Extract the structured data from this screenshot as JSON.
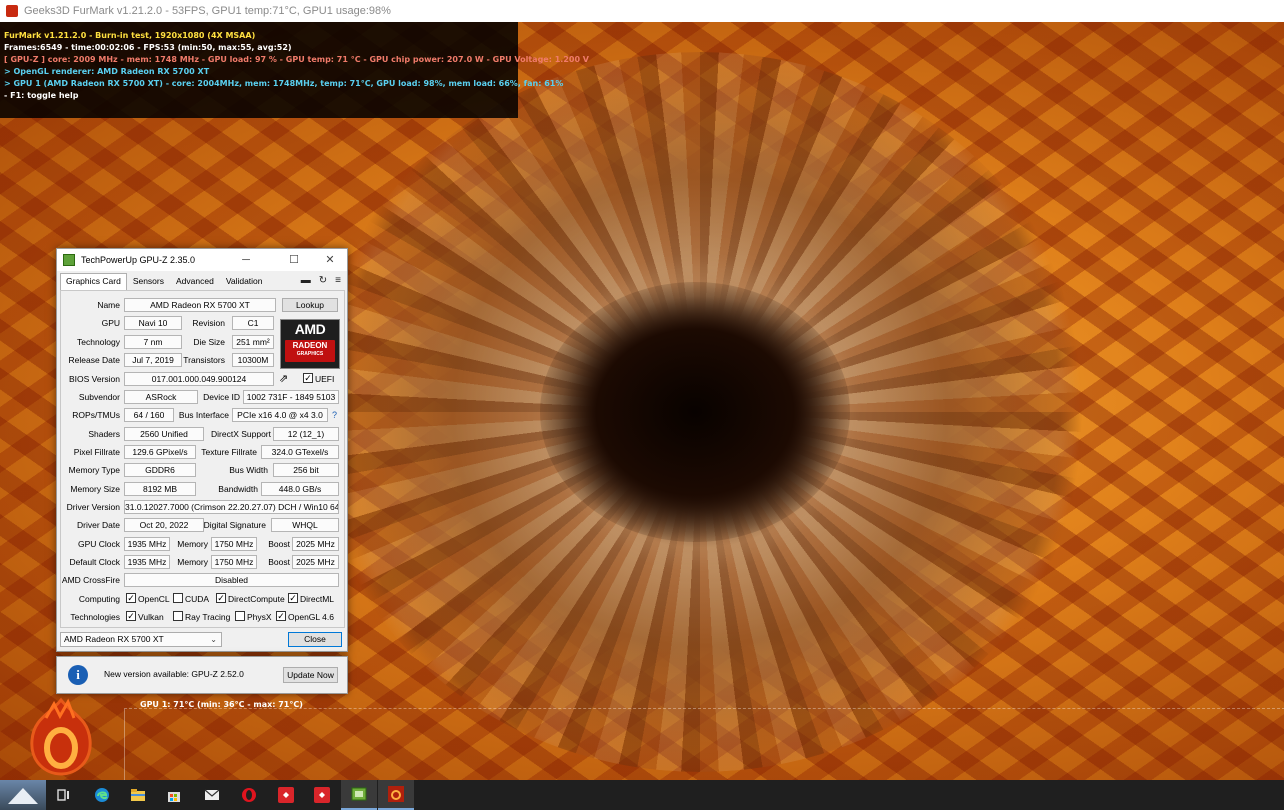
{
  "furmark": {
    "window_title": "Geeks3D FurMark v1.21.2.0 - 53FPS, GPU1 temp:71°C, GPU1 usage:98%",
    "overlay": {
      "line1": "FurMark v1.21.2.0 - Burn-in test, 1920x1080 (4X MSAA)",
      "line2": "Frames:6549 - time:00:02:06 - FPS:53 (min:50, max:55, avg:52)",
      "line3": "[ GPU-Z ] core: 2009 MHz - mem: 1748 MHz - GPU load: 97 % - GPU temp: 71 °C - GPU chip power: 207.0 W - GPU Voltage: 1.200 V",
      "line4": "> OpenGL renderer: AMD Radeon RX 5700 XT",
      "line5": "> GPU 1 (AMD Radeon RX 5700 XT) - core: 2004MHz, mem: 1748MHz, temp: 71°C, GPU load: 98%, mem load: 66%, fan: 61%",
      "line6": "- F1: toggle help"
    },
    "temp_graph_label": "GPU 1: 71°C (min: 36°C - max: 71°C)",
    "colors": {
      "yellow": "#ffe040",
      "pink": "#f07b6a",
      "cyan": "#5ad0f0"
    }
  },
  "gpuz": {
    "title": "TechPowerUp GPU-Z 2.35.0",
    "tabs": [
      "Graphics Card",
      "Sensors",
      "Advanced",
      "Validation"
    ],
    "lookup_label": "Lookup",
    "logo": {
      "brand": "AMD",
      "line1": "RADEON",
      "line2": "GRAPHICS"
    },
    "labels": {
      "name": "Name",
      "gpu": "GPU",
      "revision": "Revision",
      "technology": "Technology",
      "die_size": "Die Size",
      "release_date": "Release Date",
      "transistors": "Transistors",
      "bios_version": "BIOS Version",
      "uefi": "UEFI",
      "subvendor": "Subvendor",
      "device_id": "Device ID",
      "rops_tmus": "ROPs/TMUs",
      "bus_interface": "Bus Interface",
      "shaders": "Shaders",
      "directx": "DirectX Support",
      "pixel_fillrate": "Pixel Fillrate",
      "texture_fillrate": "Texture Fillrate",
      "memory_type": "Memory Type",
      "bus_width": "Bus Width",
      "memory_size": "Memory Size",
      "bandwidth": "Bandwidth",
      "driver_version": "Driver Version",
      "driver_date": "Driver Date",
      "digital_signature": "Digital Signature",
      "gpu_clock": "GPU Clock",
      "memory": "Memory",
      "boost": "Boost",
      "default_clock": "Default Clock",
      "crossfire": "AMD CrossFire",
      "computing": "Computing",
      "technologies": "Technologies"
    },
    "values": {
      "name": "AMD Radeon RX 5700 XT",
      "gpu": "Navi 10",
      "revision": "C1",
      "technology": "7 nm",
      "die_size": "251 mm²",
      "release_date": "Jul 7, 2019",
      "transistors": "10300M",
      "bios_version": "017.001.000.049.900124",
      "subvendor": "ASRock",
      "device_id": "1002 731F - 1849 5103",
      "rops_tmus": "64 / 160",
      "bus_interface": "PCIe x16 4.0 @ x4 3.0",
      "shaders": "2560 Unified",
      "directx": "12 (12_1)",
      "pixel_fillrate": "129.6 GPixel/s",
      "texture_fillrate": "324.0 GTexel/s",
      "memory_type": "GDDR6",
      "bus_width": "256 bit",
      "memory_size": "8192 MB",
      "bandwidth": "448.0 GB/s",
      "driver_version": "31.0.12027.7000 (Crimson 22.20.27.07) DCH / Win10 64",
      "driver_date": "Oct 20, 2022",
      "digital_signature": "WHQL",
      "gpu_clock": "1935 MHz",
      "gpu_memory": "1750 MHz",
      "gpu_boost": "2025 MHz",
      "default_clock": "1935 MHz",
      "default_memory": "1750 MHz",
      "default_boost": "2025 MHz",
      "crossfire": "Disabled"
    },
    "computing": [
      "OpenCL",
      "CUDA",
      "DirectCompute",
      "DirectML"
    ],
    "technologies": [
      "Vulkan",
      "Ray Tracing",
      "PhysX",
      "OpenGL 4.6"
    ],
    "help_mark": "?",
    "selected_gpu": "AMD Radeon RX 5700 XT",
    "close_label": "Close"
  },
  "notification": {
    "icon": "i",
    "message": "New version available: GPU-Z 2.52.0",
    "button": "Update Now"
  },
  "taskbar": {
    "icons": [
      "task-view-icon",
      "edge-icon",
      "file-explorer-icon",
      "store-icon",
      "mail-icon",
      "opera-icon",
      "anydesk-icon",
      "anydesk-icon",
      "gpuz-icon",
      "furmark-icon"
    ]
  }
}
